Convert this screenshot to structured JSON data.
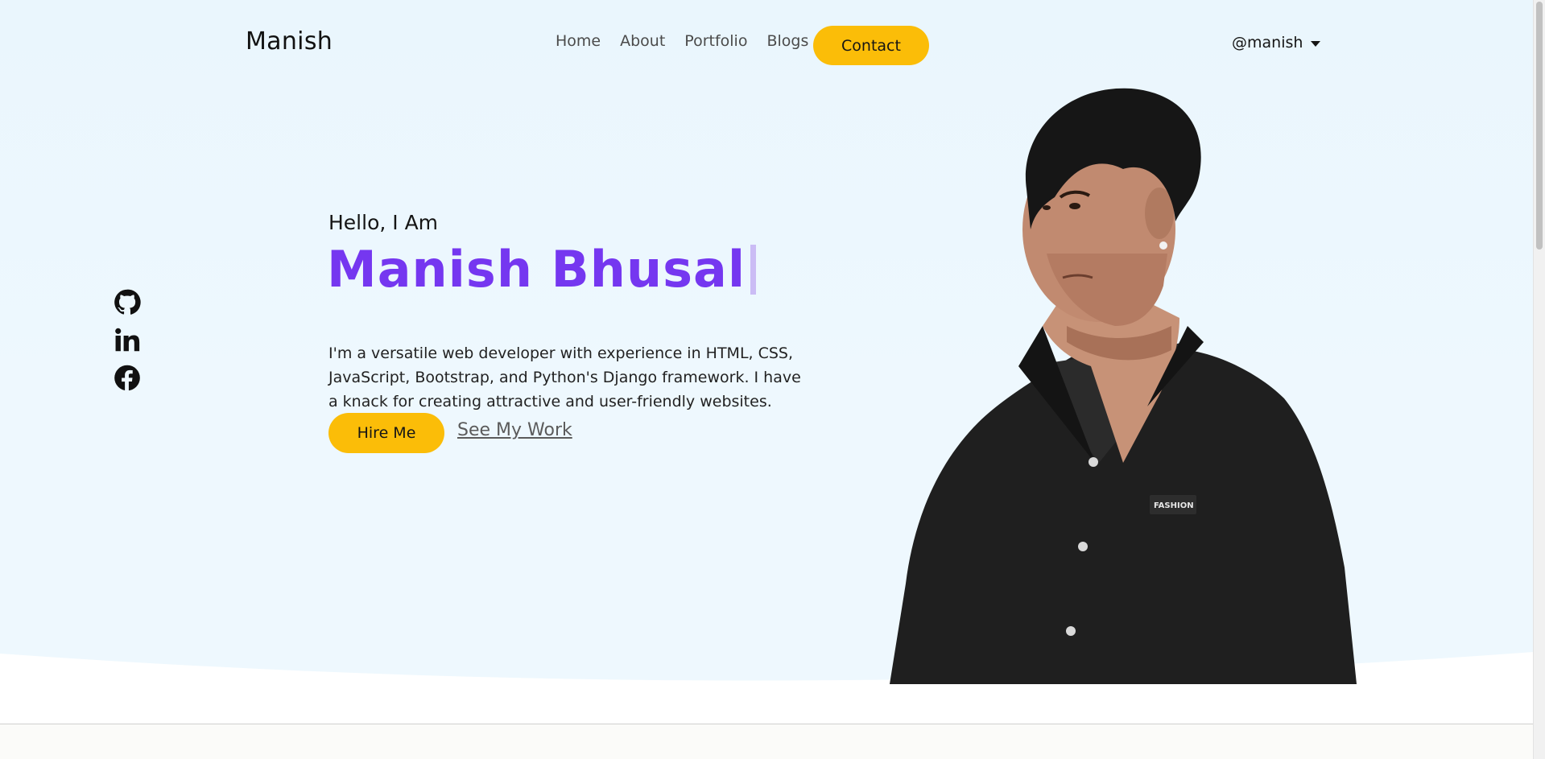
{
  "brand": "Manish",
  "nav": {
    "links": [
      "Home",
      "About",
      "Portfolio",
      "Blogs"
    ],
    "contact_label": "Contact",
    "user_handle": "@manish"
  },
  "socials": [
    {
      "icon": "github-icon"
    },
    {
      "icon": "linkedin-icon"
    },
    {
      "icon": "facebook-icon"
    }
  ],
  "hero": {
    "greeting": "Hello, I Am",
    "name": "Manish Bhusal",
    "bio": "I'm a versatile web developer with experience in HTML, CSS, JavaScript, Bootstrap, and Python's Django framework. I have a knack for creating attractive and user-friendly websites.",
    "hire_label": "Hire Me",
    "work_label": "See My Work",
    "shirt_text": "FASHION"
  },
  "colors": {
    "accent": "#fbbd08",
    "name": "#7537f0",
    "hero_bg": "#eaf6fd"
  }
}
